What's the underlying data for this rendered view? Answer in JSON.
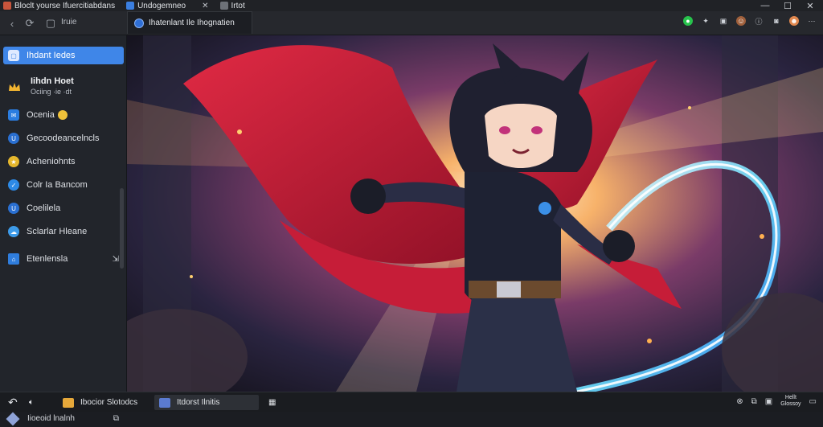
{
  "window": {
    "tabs": [
      {
        "label": "Bloclt yourse Ifuercitiabdans"
      },
      {
        "label": "Undogemneo"
      },
      {
        "label": "Irtot"
      }
    ],
    "minimize": "—",
    "maximize": "☐",
    "close": "✕"
  },
  "toolbar": {
    "address": "Iruie",
    "active_tab": "Ihatenlant Ile Ihognatien"
  },
  "sidebar": {
    "items": [
      {
        "label": "Ihdant Iedes",
        "icon": "window-icon",
        "color": "#3f86e8"
      },
      {
        "label": "Ocenia",
        "icon": "mail-icon",
        "color": "#2b7de0"
      },
      {
        "label": "Gecoodeancelncls",
        "icon": "shield-icon",
        "color": "#2a6fd1"
      },
      {
        "label": "Acheniohnts",
        "icon": "star-icon",
        "color": "#e5b72d"
      },
      {
        "label": "Colr Ia Bancom",
        "icon": "bird-icon",
        "color": "#2d8ae6"
      },
      {
        "label": "Coelilela",
        "icon": "shield-icon",
        "color": "#2a6fd1"
      },
      {
        "label": "Sclarlar Hleane",
        "icon": "cloud-icon",
        "color": "#3d9be9"
      },
      {
        "label": "Etenlensla",
        "icon": "home-icon",
        "color": "#2f7ddd"
      }
    ],
    "profile": {
      "name": "Iihdn Hoet",
      "sub": "Ociing ·ie ·dt"
    },
    "footer_label": "Iioeoid lnalnh"
  },
  "taskbar": {
    "tasks": [
      {
        "label": "Ibocior Slotodcs"
      },
      {
        "label": "Itdorst Ilnitis"
      }
    ],
    "clock_top": "Hellt",
    "clock_bottom": "Glossoy"
  },
  "colors": {
    "accent": "#3f86e8",
    "titlebar": "#202226",
    "sidebar": "#22252b",
    "taskbar": "#1a1c20"
  }
}
